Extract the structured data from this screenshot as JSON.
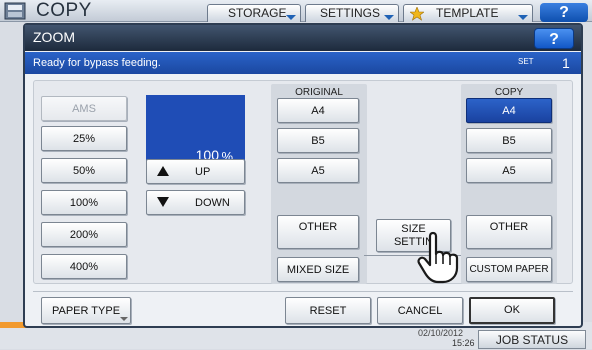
{
  "topbar": {
    "app_title": "COPY",
    "tabs": [
      {
        "label": "STORAGE"
      },
      {
        "label": "SETTINGS"
      },
      {
        "label": "TEMPLATE"
      }
    ],
    "help_label": "?"
  },
  "dialog": {
    "title": "ZOOM",
    "help_label": "?",
    "message": "Ready for bypass feeding.",
    "set_label": "SET",
    "set_count": "1"
  },
  "zoom": {
    "ams_label": "AMS",
    "presets": [
      "25%",
      "50%",
      "100%",
      "200%",
      "400%"
    ],
    "value": "100",
    "unit": "%",
    "up_label": "UP",
    "down_label": "DOWN"
  },
  "original": {
    "header": "ORIGINAL",
    "sizes": [
      "A4",
      "B5",
      "A5"
    ],
    "other_label": "OTHER",
    "mixed_label": "MIXED SIZE"
  },
  "size_setting": {
    "line1": "SIZE",
    "line2": "SETTIN"
  },
  "copy": {
    "header": "COPY",
    "sizes": [
      "A4",
      "B5",
      "A5"
    ],
    "selected": "A4",
    "other_label": "OTHER",
    "custom_label": "CUSTOM PAPER"
  },
  "footer": {
    "paper_type": "PAPER TYPE",
    "reset": "RESET",
    "cancel": "CANCEL",
    "ok": "OK"
  },
  "statusbar": {
    "date_partial": "02/10/2012",
    "time": "15:26",
    "job_status": "JOB STATUS"
  },
  "colors": {
    "accent_blue": "#1f4db6",
    "header_dark": "#1d2a3c",
    "orange": "#f29a2e"
  },
  "icons": [
    "copy-app-icon",
    "star-icon",
    "hand-pointer-icon",
    "help-icon"
  ]
}
